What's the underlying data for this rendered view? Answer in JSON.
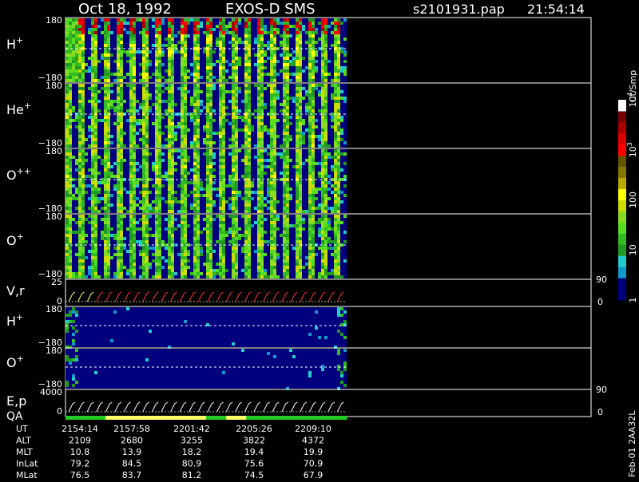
{
  "header": {
    "date": "Oct 18, 1992",
    "instrument": "EXOS-D SMS",
    "file": "s2101931.pap",
    "time": "21:54:14"
  },
  "colorbar": {
    "unit": "Ct/Smp",
    "ticks": [
      {
        "label": "1",
        "level": 0.0
      },
      {
        "label": "10",
        "level": 0.25
      },
      {
        "label": "100",
        "level": 0.5
      },
      {
        "label": "10",
        "sup": "3",
        "level": 0.75
      },
      {
        "label": "10",
        "sup": "4",
        "level": 1.0
      }
    ],
    "colors": [
      "#00007f",
      "#00007f",
      "#1199cc",
      "#22cccc",
      "#229922",
      "#33bb22",
      "#55dd22",
      "#88dd22",
      "#ccdd00",
      "#ffff00",
      "#bbaa00",
      "#887700",
      "#665500",
      "#ff0000",
      "#dd0000",
      "#aa0000",
      "#770000",
      "#ffffff"
    ]
  },
  "panels": [
    {
      "id": "h-plus",
      "label": "H",
      "sup": "+",
      "ymax": "180",
      "ymin": "−180",
      "kind": "spec",
      "intensity": 1.0
    },
    {
      "id": "he-plus",
      "label": "He",
      "sup": "+",
      "ymax": "180",
      "ymin": "−180",
      "kind": "spec",
      "intensity": 0.85
    },
    {
      "id": "o-plus-plus",
      "label": "O",
      "sup": "++",
      "ymax": "180",
      "ymin": "−180",
      "kind": "spec",
      "intensity": 0.85
    },
    {
      "id": "o-plus",
      "label": "O",
      "sup": "+",
      "ymax": "180",
      "ymin": "−180",
      "kind": "spec",
      "intensity": 0.8
    },
    {
      "id": "vr",
      "label": "V,r",
      "sup": "",
      "ymax": "25",
      "ymin": "0",
      "rmax": "90",
      "rmin": "0",
      "kind": "line"
    },
    {
      "id": "h-plus-2",
      "label": "H",
      "sup": "+",
      "ymax": "180",
      "ymin": "−180",
      "kind": "low",
      "intensity": 0.3
    },
    {
      "id": "o-plus-2",
      "label": "O",
      "sup": "+",
      "ymax": "180",
      "ymin": "−180",
      "kind": "low",
      "intensity": 0.15
    },
    {
      "id": "ep",
      "label": "E,p",
      "label2": "QA",
      "sup": "",
      "ymax": "4000",
      "ymin": "0",
      "rmax": "90",
      "rmin": "0",
      "kind": "line"
    }
  ],
  "table": {
    "rows": [
      {
        "name": "UT",
        "values": [
          "2154:14",
          "2157:58",
          "2201:42",
          "2205:26",
          "2209:10"
        ]
      },
      {
        "name": "ALT",
        "values": [
          "2109",
          "2680",
          "3255",
          "3822",
          "4372"
        ]
      },
      {
        "name": "MLT",
        "values": [
          "10.8",
          "13.9",
          "18.2",
          "19.4",
          "19.9"
        ]
      },
      {
        "name": "InLat",
        "values": [
          "79.2",
          "84.5",
          "80.9",
          "75.6",
          "70.9"
        ]
      },
      {
        "name": "MLat",
        "values": [
          "76.5",
          "83.7",
          "81.2",
          "74.5",
          "67.9"
        ]
      }
    ]
  },
  "footer": {
    "code": "Feb-01  2AA32L"
  },
  "qa_bar": [
    "#22cc22",
    "#22cc22",
    "#ffff66",
    "#ffff66",
    "#ffff66",
    "#ffff66",
    "#ffff66",
    "#22cc22",
    "#ffff66",
    "#22cc22",
    "#22cc22",
    "#22cc22",
    "#22cc22",
    "#22cc22"
  ],
  "chart_data": {
    "type": "heatmap",
    "title": "Oct 18, 1992  EXOS-D SMS",
    "x": [
      "2154:14",
      "2157:58",
      "2201:42",
      "2205:26",
      "2209:10"
    ],
    "xlabel": "UT",
    "series": [
      {
        "name": "H+",
        "ylim": [
          -180,
          180
        ]
      },
      {
        "name": "He+",
        "ylim": [
          -180,
          180
        ]
      },
      {
        "name": "O++",
        "ylim": [
          -180,
          180
        ]
      },
      {
        "name": "O+",
        "ylim": [
          -180,
          180
        ]
      },
      {
        "name": "V,r",
        "ylim": [
          0,
          25
        ]
      },
      {
        "name": "H+",
        "ylim": [
          -180,
          180
        ]
      },
      {
        "name": "O+",
        "ylim": [
          -180,
          180
        ]
      },
      {
        "name": "E,p",
        "ylim": [
          0,
          4000
        ]
      }
    ],
    "colorscale": {
      "label": "Ct/Smp",
      "range": [
        1,
        10000
      ],
      "log": true
    }
  }
}
